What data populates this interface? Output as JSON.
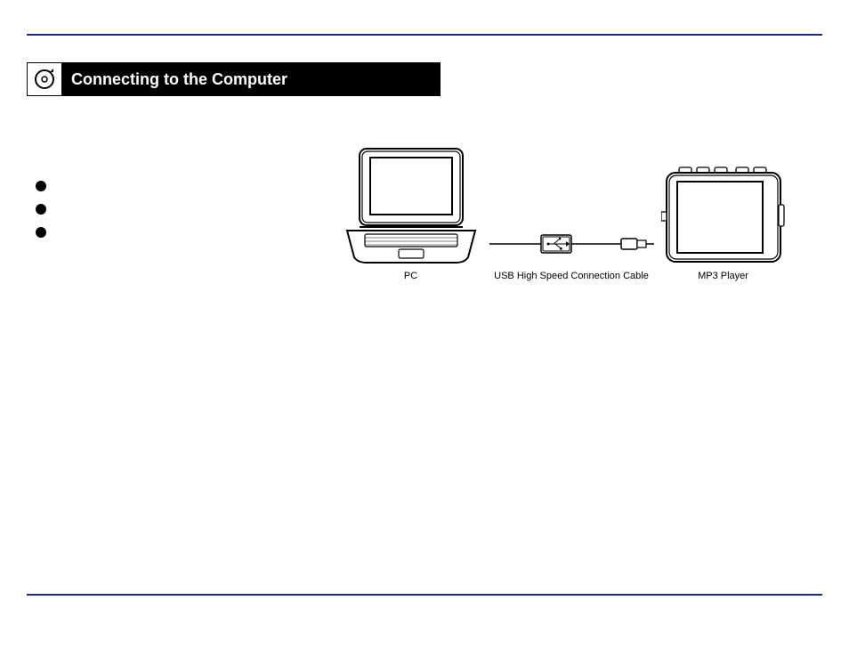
{
  "section_title": "Connecting to the Computer",
  "bullets": [
    {
      "text": ""
    },
    {
      "text": ""
    },
    {
      "text": ""
    }
  ],
  "diagram": {
    "pc_label": "PC",
    "cable_label": "USB High Speed Connection Cable",
    "player_label": "MP3 Player"
  },
  "page_number": ""
}
